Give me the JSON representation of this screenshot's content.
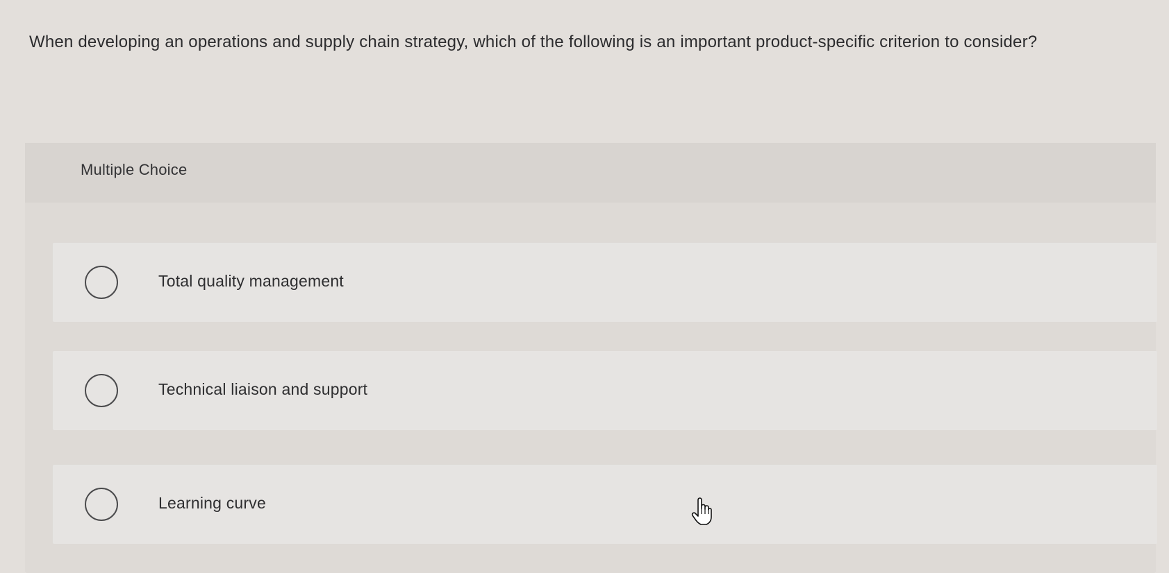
{
  "question": {
    "text": "When developing an operations and supply chain strategy, which of the following is an important product-specific criterion to consider?"
  },
  "multiple_choice": {
    "label": "Multiple Choice",
    "options": [
      {
        "label": "Total quality management"
      },
      {
        "label": "Technical liaison and support"
      },
      {
        "label": "Learning curve"
      }
    ]
  },
  "icons": {
    "radio": "radio-unselected-icon",
    "pointer": "hand-pointer-icon"
  }
}
